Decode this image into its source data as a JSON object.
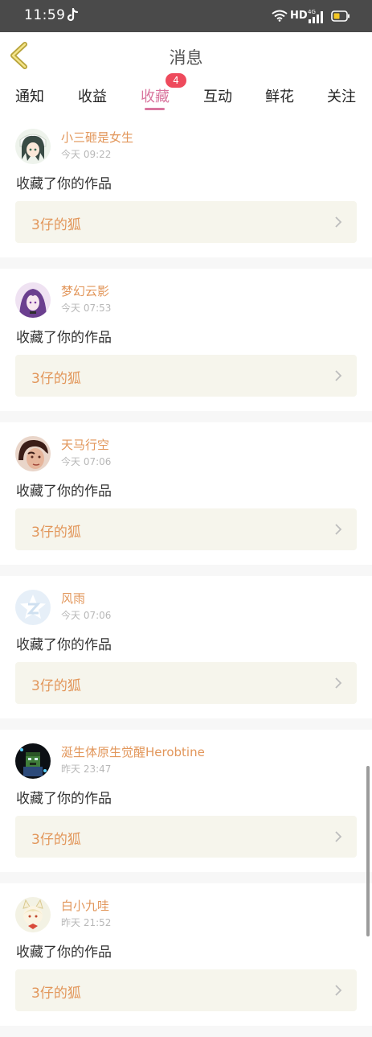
{
  "status_bar": {
    "time": "11:59",
    "network": "HD",
    "signal_label": "4G"
  },
  "header": {
    "title": "消息"
  },
  "tabs": [
    {
      "label": "通知"
    },
    {
      "label": "收益"
    },
    {
      "label": "收藏",
      "badge": "4",
      "active": true
    },
    {
      "label": "互动"
    },
    {
      "label": "鲜花"
    },
    {
      "label": "关注"
    }
  ],
  "messages": [
    {
      "user": "小三砸是女生",
      "time": "今天 09:22",
      "action": "收藏了你的作品",
      "work": "3仔的狐"
    },
    {
      "user": "梦幻云影",
      "time": "今天 07:53",
      "action": "收藏了你的作品",
      "work": "3仔的狐"
    },
    {
      "user": "天马行空",
      "time": "今天 07:06",
      "action": "收藏了你的作品",
      "work": "3仔的狐"
    },
    {
      "user": "风雨",
      "time": "今天 07:06",
      "action": "收藏了你的作品",
      "work": "3仔的狐"
    },
    {
      "user": "涎生体原生觉醒Herobtine",
      "time": "昨天 23:47",
      "action": "收藏了你的作品",
      "work": "3仔的狐"
    },
    {
      "user": "白小九哇",
      "time": "昨天 21:52",
      "action": "收藏了你的作品",
      "work": "3仔的狐"
    }
  ],
  "colors": {
    "accent": "#d9759e",
    "username": "#e2965a",
    "badge": "#ee4a5c",
    "link_bg": "#f6f5ec"
  }
}
